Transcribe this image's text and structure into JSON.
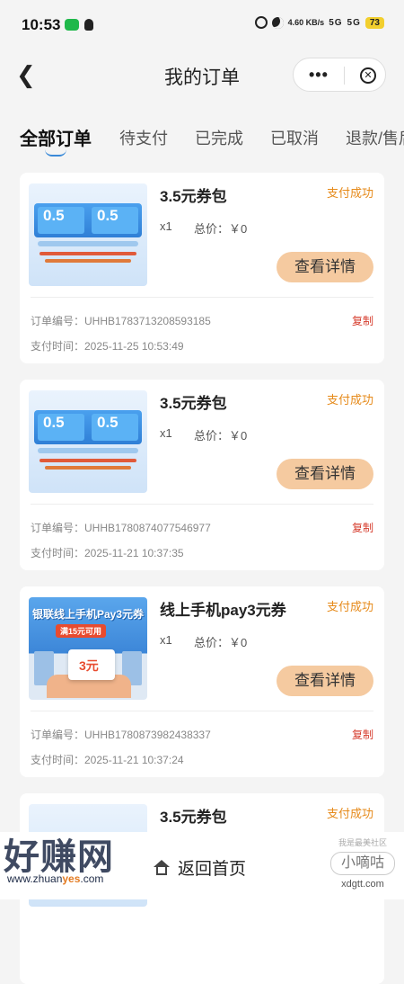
{
  "status_bar": {
    "time": "10:53",
    "speed": "4.60 KB/s",
    "signal_1": "5G",
    "signal_2": "5G",
    "battery": "73"
  },
  "header": {
    "title": "我的订单",
    "more_icon": "more-dots-icon",
    "close_icon": "close-circle-icon"
  },
  "tabs": [
    {
      "label": "全部订单",
      "active": true
    },
    {
      "label": "待支付"
    },
    {
      "label": "已完成"
    },
    {
      "label": "已取消"
    },
    {
      "label": "退款/售后"
    }
  ],
  "orders": [
    {
      "name": "3.5元券包",
      "status": "支付成功",
      "qty": "x1",
      "total": "总价：￥0",
      "detail_label": "查看详情",
      "order_no": "订单编号：UHHB1783713208593185",
      "copy_label": "复制",
      "pay_time": "支付时间：2025-11-25 10:53:49",
      "thumb": {
        "coupon_value": "0.5"
      }
    },
    {
      "name": "3.5元券包",
      "status": "支付成功",
      "qty": "x1",
      "total": "总价：￥0",
      "detail_label": "查看详情",
      "order_no": "订单编号：UHHB1780874077546977",
      "copy_label": "复制",
      "pay_time": "支付时间：2025-11-21 10:37:35",
      "thumb": {
        "coupon_value": "0.5"
      }
    },
    {
      "name": "线上手机pay3元券",
      "status": "支付成功",
      "qty": "x1",
      "total": "总价：￥0",
      "detail_label": "查看详情",
      "order_no": "订单编号：UHHB1780873982438337",
      "copy_label": "复制",
      "pay_time": "支付时间：2025-11-21 10:37:24",
      "thumb": {
        "headline": "银联线上手机Pay3元券",
        "sub": "满15元可用",
        "amount": "3元"
      }
    },
    {
      "name": "3.5元券包",
      "status": "支付成功"
    }
  ],
  "bottom": {
    "home_label": "返回首页"
  },
  "watermark": {
    "left_big": "好赚网",
    "left_url_a": "www.zhuan",
    "left_url_b": "yes",
    "left_url_c": ".com",
    "right_small": "我是最美社区",
    "right_logo": "小嘀咕",
    "right_site": "xdgtt.com"
  },
  "colors": {
    "accent_status": "#e68a1a",
    "detail_button": "#f5caa0",
    "copy_red": "#d63d2e",
    "tab_underline": "#3a8ad8"
  }
}
